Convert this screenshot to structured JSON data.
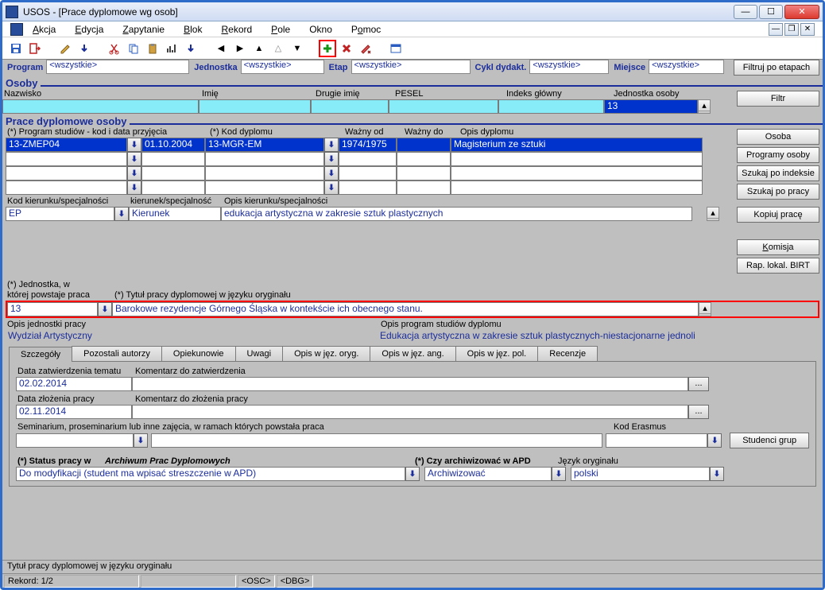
{
  "window": {
    "title": "USOS - [Prace dyplomowe wg osob]"
  },
  "menu": {
    "akcja": "Akcja",
    "edycja": "Edycja",
    "zapytanie": "Zapytanie",
    "blok": "Blok",
    "rekord": "Rekord",
    "pole": "Pole",
    "okno": "Okno",
    "pomoc": "Pomoc"
  },
  "filters": {
    "program": "Program",
    "program_val": "<wszystkie>",
    "jednostka": "Jednostka",
    "jednostka_val": "<wszystkie>",
    "etap": "Etap",
    "etap_val": "<wszystkie>",
    "cykl": "Cykl dydakt.",
    "cykl_val": "<wszystkie>",
    "miejsce": "Miejsce",
    "miejsce_val": "<wszystkie>",
    "filtruj_btn": "Filtruj po etapach"
  },
  "osoby": {
    "heading": "Osoby",
    "col_nazwisko": "Nazwisko",
    "col_imie": "Imię",
    "col_drugie": "Drugie imię",
    "col_pesel": "PESEL",
    "col_indeks": "Indeks główny",
    "col_jedn": "Jednostka osoby",
    "jednostka_val": "13"
  },
  "prace": {
    "heading": "Prace dyplomowe osoby",
    "col_program": "(*) Program studiów - kod i data przyjęcia",
    "col_kod_dypl": "(*) Kod dyplomu",
    "col_wazny_od": "Ważny od",
    "col_wazny_do": "Ważny do",
    "col_opis": "Opis dyplomu",
    "rows": [
      {
        "kod": "13-ZMEP04",
        "data": "01.10.2004",
        "dypl": "13-MGR-EM",
        "wazny_od": "1974/1975",
        "wazny_do": "",
        "opis": "Magisterium ze sztuki"
      },
      {
        "kod": "",
        "data": "",
        "dypl": "",
        "wazny_od": "",
        "wazny_do": "",
        "opis": ""
      },
      {
        "kod": "",
        "data": "",
        "dypl": "",
        "wazny_od": "",
        "wazny_do": "",
        "opis": ""
      },
      {
        "kod": "",
        "data": "",
        "dypl": "",
        "wazny_od": "",
        "wazny_do": "",
        "opis": ""
      }
    ],
    "kod_kier_lbl": "Kod kierunku/specjalności",
    "kier_lbl": "kierunek/specjalność",
    "opis_kier_lbl": "Opis kierunku/specjalności",
    "kod_kier": "EP",
    "kier": "Kierunek",
    "opis_kier": "edukacja artystyczna w zakresie sztuk  plastycznych"
  },
  "sidebar": {
    "filtr": "Filtr",
    "osoba": "Osoba",
    "programy": "Programy osoby",
    "szukaj_ind": "Szukaj po indeksie",
    "szukaj_pracy": "Szukaj po pracy",
    "kopiuj": "Kopiuj pracę",
    "komisja": "Komisja",
    "rap": "Rap. lokal. BIRT"
  },
  "jednostkaPraca": {
    "lbl1": "(*) Jednostka, w",
    "lbl2": "której powstaje praca",
    "lbl_tytul": "(*) Tytuł pracy dyplomowej w języku oryginału",
    "jedn": "13",
    "tytul": "Barokowe rezydencje Górnego Śląska w kontekście ich obecnego stanu.",
    "lbl_opis_jedn": "Opis jednostki pracy",
    "opis_jedn": "Wydział Artystyczny",
    "lbl_opis_prog": "Opis program studiów dyplomu",
    "opis_prog": "Edukacja artystyczna w zakresie sztuk plastycznych-niestacjonarne jednoli"
  },
  "tabs": {
    "szczegoly": "Szczegóły",
    "pozostali": "Pozostali autorzy",
    "opiekunowie": "Opiekunowie",
    "uwagi": "Uwagi",
    "opis_oryg": "Opis w jęz. oryg.",
    "opis_ang": "Opis w jęz. ang.",
    "opis_pol": "Opis w jęz. pol.",
    "recenzje": "Recenzje"
  },
  "details": {
    "lbl_data_zat": "Data zatwierdzenia tematu",
    "data_zat": "02.02.2014",
    "lbl_kom_zat": "Komentarz do zatwierdzenia",
    "kom_zat": "",
    "lbl_data_zlo": "Data złożenia pracy",
    "data_zlo": "02.11.2014",
    "lbl_kom_zlo": "Komentarz do złożenia pracy",
    "kom_zlo": "",
    "lbl_sem": "Seminarium, proseminarium lub inne zajęcia, w ramach których powstała praca",
    "sem": "",
    "lbl_era": "Kod Erasmus",
    "era": "",
    "btn_studenci": "Studenci grup",
    "lbl_status": "(*) Status pracy w",
    "lbl_status_it": "Archiwum Prac Dyplomowych",
    "status": "Do modyfikacji (student ma wpisać streszczenie w APD)",
    "lbl_arch": "(*) Czy archiwizować w APD",
    "arch": "Archiwizować",
    "lbl_lang": "Język oryginału",
    "lang": "polski"
  },
  "status_strip": "Tytuł pracy dyplomowej w języku oryginału",
  "statusbar": {
    "rec": "Rekord: 1/2",
    "osc": "<OSC>",
    "dbg": "<DBG>"
  }
}
